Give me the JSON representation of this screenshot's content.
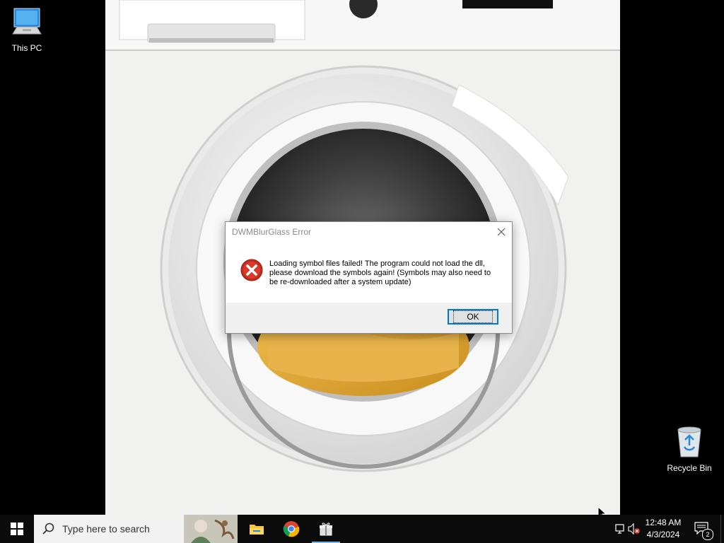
{
  "desktop": {
    "icons": [
      {
        "label": "This PC"
      },
      {
        "label": "Recycle Bin"
      }
    ],
    "wallpaper": "washing-machine-photo"
  },
  "dialog": {
    "title": "DWMBlurGlass Error",
    "message": "Loading symbol files failed! The program could not load the dll, please download the symbols again! (Symbols may also need to be re-downloaded after a system update)",
    "ok_label": "OK",
    "icon": "error-icon"
  },
  "taskbar": {
    "search_placeholder": "Type here to search",
    "apps": [
      {
        "name": "File Explorer",
        "icon": "folder-icon"
      },
      {
        "name": "Google Chrome",
        "icon": "chrome-icon"
      },
      {
        "name": "DWMBlurGlass",
        "icon": "gift-icon",
        "active": true
      }
    ],
    "clock": {
      "time": "12:48 AM",
      "date": "4/3/2024"
    },
    "notification_count": "2"
  },
  "colors": {
    "accent": "#0078d7",
    "taskbar": "#0b0b0b",
    "error_red": "#c42b1c"
  }
}
